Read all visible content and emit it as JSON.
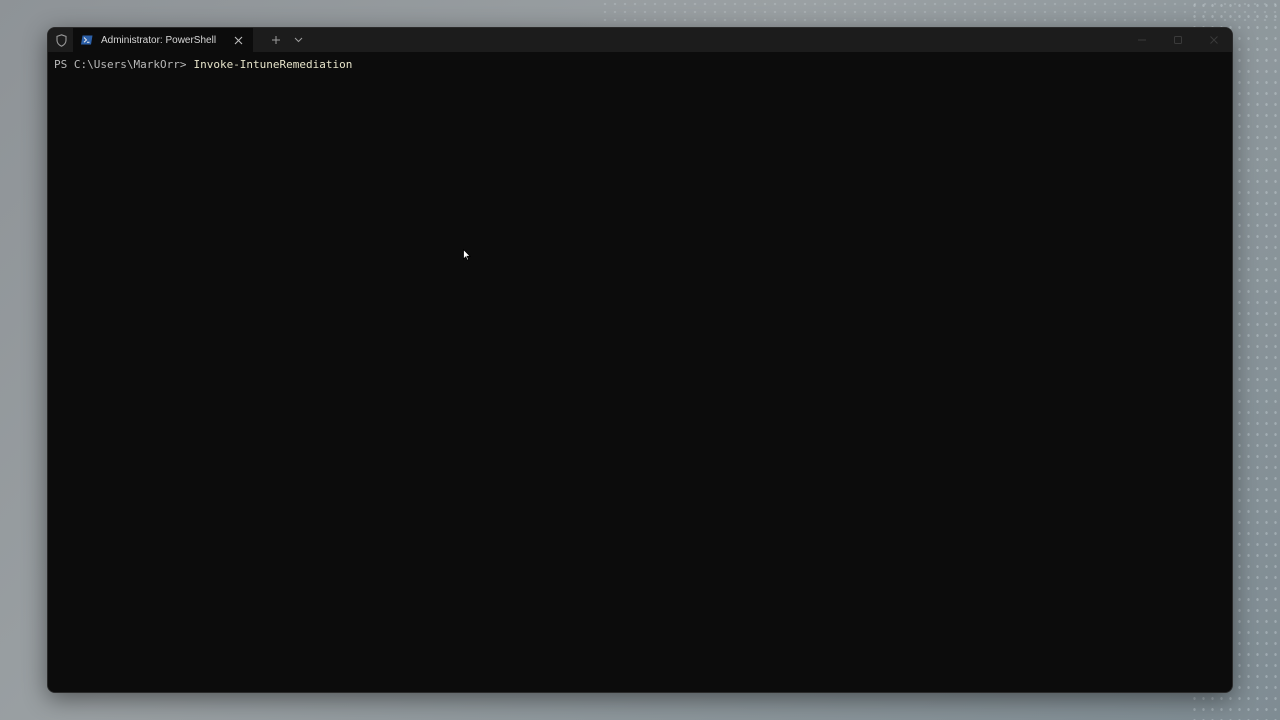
{
  "window": {
    "tab_title": "Administrator: PowerShell",
    "tab_icon": "powershell-icon",
    "shield_icon": "shield-icon",
    "new_tab_icon": "plus-icon",
    "dropdown_icon": "chevron-down-icon",
    "close_tab_icon": "close-icon",
    "caption": {
      "minimize_icon": "minimize-icon",
      "maximize_icon": "maximize-icon",
      "close_icon": "close-icon"
    }
  },
  "console": {
    "prompt": "PS C:\\Users\\MarkOrr>",
    "command": "Invoke-IntuneRemediation"
  },
  "colors": {
    "console_bg": "#0c0c0c",
    "titlebar_bg": "#1c1c1c",
    "prompt_text": "#b9b9b9",
    "command_text": "#e6e3c9"
  }
}
